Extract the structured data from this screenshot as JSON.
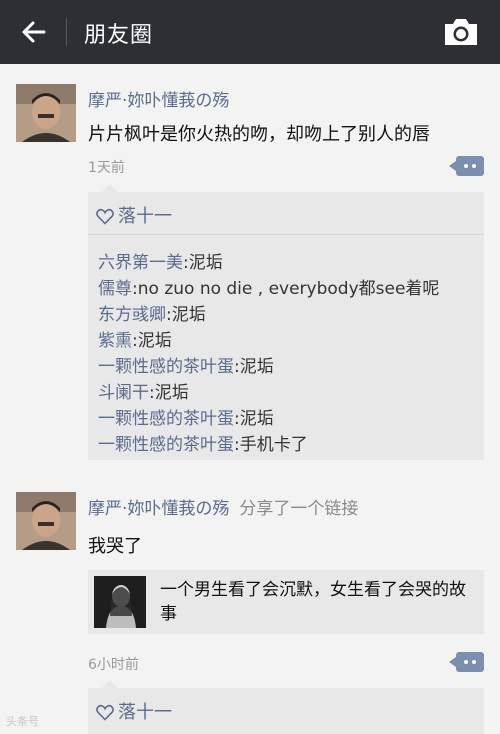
{
  "header": {
    "title": "朋友圈",
    "back_icon": "back-arrow-icon",
    "camera_icon": "camera-icon"
  },
  "posts": [
    {
      "author": "摩严·妳卟懂莪の殇",
      "text": "片片枫叶是你火热的吻，却吻上了别人的唇",
      "time": "1天前",
      "likes": "落十一",
      "comments": [
        {
          "author": "六界第一美",
          "sep": ":",
          "text": "泥垢"
        },
        {
          "author": "儒尊",
          "sep": ":",
          "text": "no zuo no die , everybody都see着呢"
        },
        {
          "author": "东方彧卿",
          "sep": ":",
          "text": "泥垢"
        },
        {
          "author": "紫熏",
          "sep": ":",
          "text": "泥垢"
        },
        {
          "author": "一颗性感的茶叶蛋",
          "sep": ":",
          "text": "泥垢"
        },
        {
          "author": "斗阑干",
          "sep": ":",
          "text": "泥垢"
        },
        {
          "author": "一颗性感的茶叶蛋",
          "sep": ":",
          "text": "泥垢"
        },
        {
          "author": "一颗性感的茶叶蛋",
          "sep": ":",
          "text": "手机卡了"
        }
      ]
    },
    {
      "author": "摩严·妳卟懂莪の殇",
      "share_note": "分享了一个链接",
      "text": "我哭了",
      "link_title": "一个男生看了会沉默，女生看了会哭的故事",
      "time": "6小时前",
      "likes": "落十一"
    }
  ],
  "watermark": "头条号",
  "colors": {
    "header_bg": "#2d2f33",
    "name_blue": "#5b6b8e",
    "page_bg": "#f3f3f3",
    "panel_bg": "#e8e8e8"
  }
}
